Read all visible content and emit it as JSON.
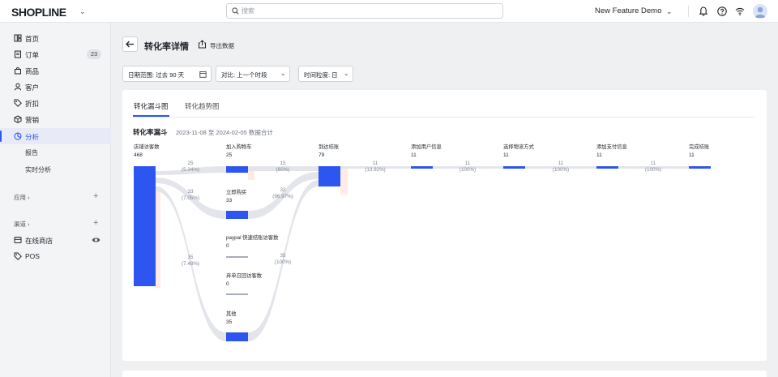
{
  "topbar": {
    "logo": "SHOPLINE",
    "search_placeholder": "搜索",
    "store_name": "New Feature Demo"
  },
  "sidebar": {
    "items": [
      {
        "label": "首页",
        "icon": "home-icon"
      },
      {
        "label": "订单",
        "icon": "order-icon",
        "badge": "23"
      },
      {
        "label": "商品",
        "icon": "bag-icon"
      },
      {
        "label": "客户",
        "icon": "user-icon"
      },
      {
        "label": "折扣",
        "icon": "tag-icon"
      },
      {
        "label": "营销",
        "icon": "megaphone-icon"
      },
      {
        "label": "分析",
        "icon": "analytics-icon",
        "active": true
      }
    ],
    "sub_items": [
      "报告",
      "实时分析"
    ],
    "apps_label": "应用",
    "channels_label": "渠道",
    "channels": [
      {
        "label": "在线商店",
        "icon": "store-icon"
      },
      {
        "label": "POS",
        "icon": "pos-tag-icon"
      }
    ]
  },
  "header": {
    "title": "转化率详情",
    "export_label": "导出数据"
  },
  "filters": {
    "date_range": "日期范围: 过去 90 天",
    "compare": "对比: 上一个时段",
    "granularity": "时间粒度: 日"
  },
  "tabs": [
    "转化漏斗图",
    "转化趋势图"
  ],
  "section": {
    "title": "转化率漏斗",
    "subtitle": "2023-11-08 至 2024-02-05 数据合计"
  },
  "colors": {
    "accent": "#2d55f0",
    "link": "#e3e5ea",
    "ghost": "#fde2dc"
  },
  "chart_data": {
    "type": "sankey",
    "stages": [
      {
        "id": "s0",
        "name": "店铺访客数",
        "value": 468
      },
      {
        "id": "s1",
        "name": "加入购物车",
        "value": 25
      },
      {
        "id": "s2",
        "name": "立即购买",
        "value": 33
      },
      {
        "id": "s3",
        "name": "paypal 快速结账访客数",
        "value": 0
      },
      {
        "id": "s4",
        "name": "弃单召回访客数",
        "value": 0
      },
      {
        "id": "s5",
        "name": "其他",
        "value": 35
      },
      {
        "id": "s6",
        "name": "到达结账",
        "value": 79
      },
      {
        "id": "s7",
        "name": "添加用户信息",
        "value": 11
      },
      {
        "id": "s8",
        "name": "选择物流方式",
        "value": 11
      },
      {
        "id": "s9",
        "name": "添加支付信息",
        "value": 11
      },
      {
        "id": "s10",
        "name": "完成结账",
        "value": 11
      }
    ],
    "links": [
      {
        "from": "s0",
        "to": "s1",
        "value": "25",
        "pct": "(5.34%)"
      },
      {
        "from": "s0",
        "to": "s2",
        "value": "33",
        "pct": "(7.05%)"
      },
      {
        "from": "s0",
        "to": "s5",
        "value": "35",
        "pct": "(7.48%)"
      },
      {
        "from": "s1",
        "to": "s6",
        "value": "15",
        "pct": "(60%)"
      },
      {
        "from": "s2",
        "to": "s6",
        "value": "32",
        "pct": "(96.97%)"
      },
      {
        "from": "s5",
        "to": "s6",
        "value": "35",
        "pct": "(100%)"
      },
      {
        "from": "s6",
        "to": "s7",
        "value": "11",
        "pct": "(13.92%)"
      },
      {
        "from": "s7",
        "to": "s8",
        "value": "11",
        "pct": "(100%)"
      },
      {
        "from": "s8",
        "to": "s9",
        "value": "11",
        "pct": "(100%)"
      },
      {
        "from": "s9",
        "to": "s10",
        "value": "11",
        "pct": "(100%)"
      }
    ]
  }
}
